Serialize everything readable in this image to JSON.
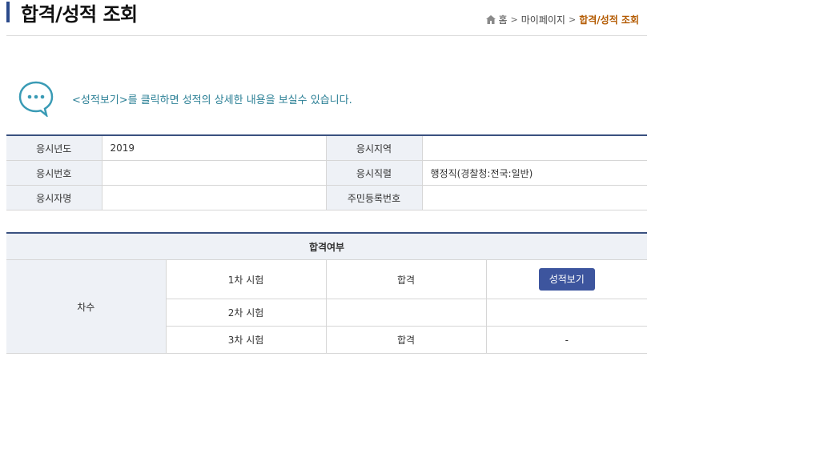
{
  "header": {
    "title": "합격/성적 조회",
    "breadcrumb": {
      "home": "홈",
      "mypage": "마이페이지",
      "current": "합격/성적 조회"
    }
  },
  "notice": {
    "text": "<성적보기>를 클릭하면 성적의 상세한 내용을 보실수 있습니다."
  },
  "info": {
    "year_label": "응시년도",
    "year_value": "2019",
    "region_label": "응시지역",
    "region_value": "",
    "number_label": "응시번호",
    "number_value": "",
    "job_label": "응시직렬",
    "job_value": "행정직(경찰청:전국:일반)",
    "name_label": "응시자명",
    "name_value": "",
    "id_label": "주민등록번호",
    "id_value": ""
  },
  "result": {
    "header": "합격여부",
    "round_label": "차수",
    "rows": [
      {
        "exam": "1차 시험",
        "status": "합격",
        "action": "성적보기"
      },
      {
        "exam": "2차 시험",
        "status": "",
        "action": ""
      },
      {
        "exam": "3차 시험",
        "status": "합격",
        "action": "-"
      }
    ]
  }
}
